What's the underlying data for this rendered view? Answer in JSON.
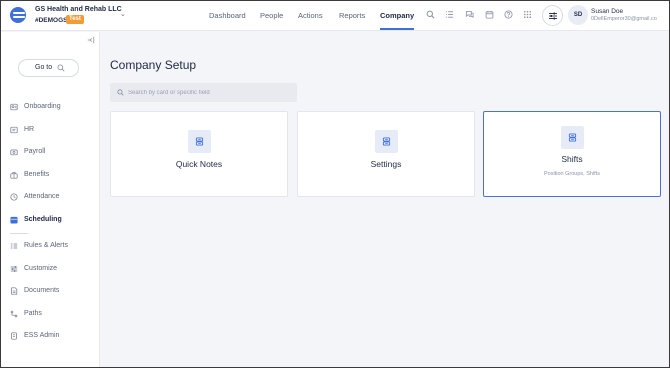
{
  "header": {
    "company_name": "GS Health and Rehab LLC",
    "company_code": "#DEMOGS",
    "test_badge": "Test",
    "nav": [
      {
        "label": "Dashboard"
      },
      {
        "label": "People"
      },
      {
        "label": "Actions"
      },
      {
        "label": "Reports"
      },
      {
        "label": "Company",
        "active": true
      }
    ],
    "icons": [
      "search-icon",
      "list-icon",
      "chat-icon",
      "calendar-icon",
      "help-icon",
      "apps-grid-icon",
      "filters-icon"
    ],
    "user": {
      "initials": "SD",
      "name": "Susan Doe",
      "email": "0DellEmperor30@gmail.co"
    }
  },
  "sidebar": {
    "goto_label": "Go to",
    "items": [
      {
        "label": "Onboarding",
        "icon": "onboarding-icon"
      },
      {
        "label": "HR",
        "icon": "hr-icon"
      },
      {
        "label": "Payroll",
        "icon": "payroll-icon"
      },
      {
        "label": "Benefits",
        "icon": "benefits-icon"
      },
      {
        "label": "Attendance",
        "icon": "attendance-icon"
      },
      {
        "label": "Scheduling",
        "icon": "scheduling-icon",
        "active": true
      },
      {
        "label": "Rules & Alerts",
        "icon": "rules-icon"
      },
      {
        "label": "Customize",
        "icon": "customize-icon"
      },
      {
        "label": "Documents",
        "icon": "documents-icon"
      },
      {
        "label": "Paths",
        "icon": "paths-icon"
      },
      {
        "label": "ESS Admin",
        "icon": "ess-admin-icon"
      }
    ]
  },
  "main": {
    "title": "Company Setup",
    "search_placeholder": "Search by card or specific field",
    "cards": [
      {
        "title": "Quick Notes",
        "subtitle": ""
      },
      {
        "title": "Settings",
        "subtitle": ""
      },
      {
        "title": "Shifts",
        "subtitle": "Position Groups, Shifts",
        "selected": true
      }
    ]
  },
  "colors": {
    "accent": "#3f6fd8",
    "badge": "#f29c38",
    "text": "#1f2a44",
    "background": "#f4f5f8"
  }
}
